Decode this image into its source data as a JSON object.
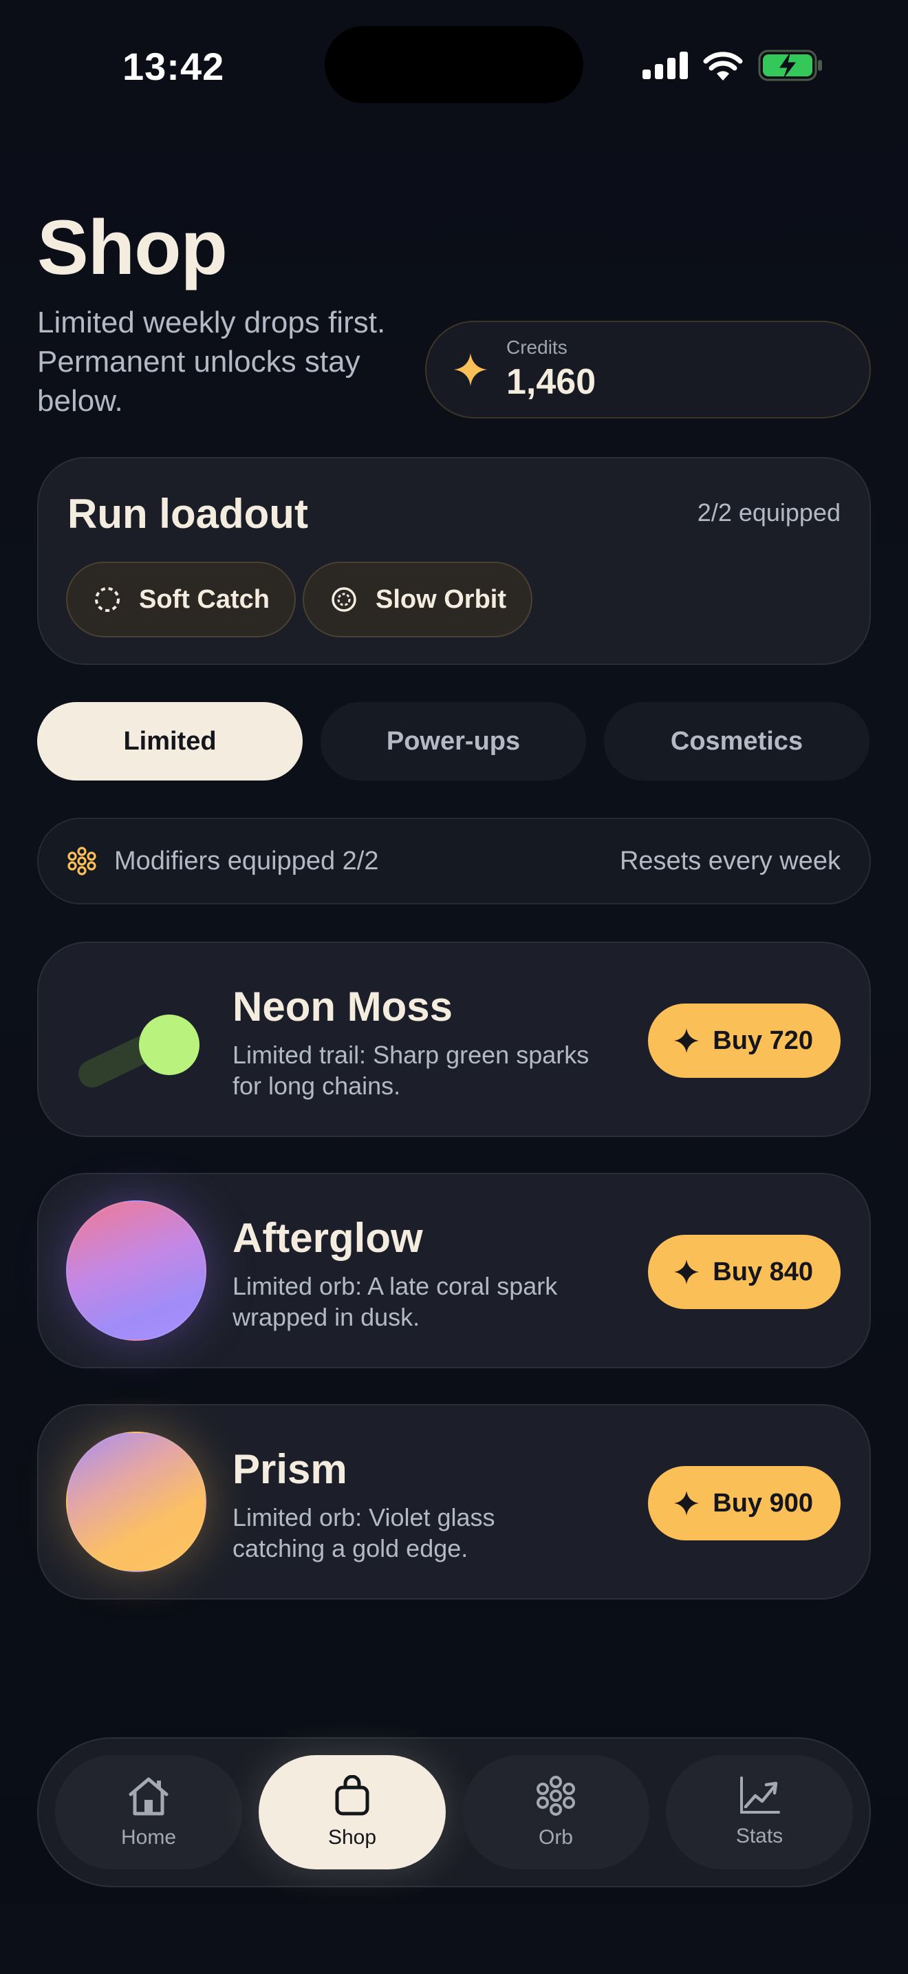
{
  "status_bar": {
    "time": "13:42"
  },
  "header": {
    "title": "Shop",
    "subtitle": "Limited weekly drops first. Permanent unlocks stay below."
  },
  "credits": {
    "label": "Credits",
    "value": "1,460",
    "icon": "sparkle-icon"
  },
  "loadout": {
    "title": "Run loadout",
    "count": "2/2 equipped",
    "chips": [
      {
        "label": "Soft Catch",
        "icon": "dashed-circle-icon"
      },
      {
        "label": "Slow Orbit",
        "icon": "orbit-icon"
      }
    ]
  },
  "tabs": [
    {
      "label": "Limited",
      "active": true
    },
    {
      "label": "Power-ups",
      "active": false
    },
    {
      "label": "Cosmetics",
      "active": false
    }
  ],
  "modifiers_bar": {
    "label": "Modifiers equipped 2/2",
    "reset_text": "Resets every week",
    "icon": "flower-cluster-icon"
  },
  "items": [
    {
      "name": "Neon Moss",
      "description": "Limited trail: Sharp green sparks for long chains.",
      "button": "Buy 720",
      "visual": "trail"
    },
    {
      "name": "Afterglow",
      "description": "Limited orb: A late coral spark wrapped in dusk.",
      "button": "Buy 840",
      "visual": "orb"
    },
    {
      "name": "Prism",
      "description": "Limited orb: Violet glass catching a gold edge.",
      "button": "Buy 900",
      "visual": "orb"
    }
  ],
  "nav": [
    {
      "label": "Home",
      "icon": "home-icon",
      "active": false
    },
    {
      "label": "Shop",
      "icon": "shopping-bag-icon",
      "active": true
    },
    {
      "label": "Orb",
      "icon": "orb-cluster-icon",
      "active": false
    },
    {
      "label": "Stats",
      "icon": "chart-line-icon",
      "active": false
    }
  ],
  "colors": {
    "accent": "#fbbf57",
    "cream": "#f3ecdf",
    "background": "#0b0e17",
    "neon_green": "#b9f27c"
  }
}
